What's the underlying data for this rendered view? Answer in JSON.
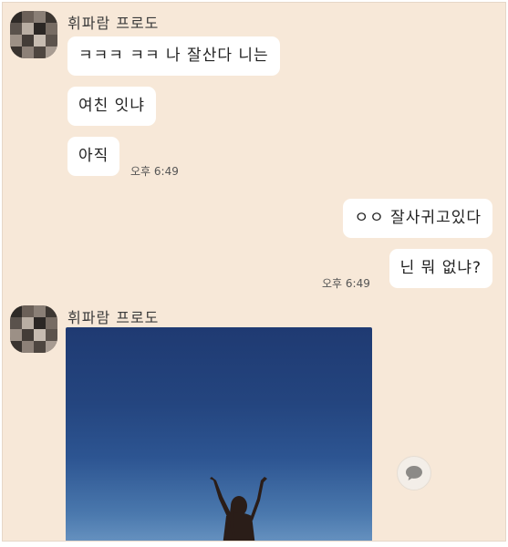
{
  "messages": {
    "sender_name": "휘파람 프로도",
    "received": [
      {
        "text": "ㅋㅋㅋ ㅋㅋ 나 잘산다 니는"
      },
      {
        "text": "여친 잇냐"
      },
      {
        "text": "아직"
      }
    ],
    "received_time": "오후 6:49",
    "sent": [
      {
        "text": "ㅇㅇ 잘사귀고있다"
      },
      {
        "text": "닌 뭐 없냐?"
      }
    ],
    "sent_time": "오후 6:49",
    "second_sender_name": "휘파람 프로도"
  },
  "icons": {
    "share": "speech-bubble-icon"
  },
  "colors": {
    "chat_background": "#f7e8d8",
    "bubble": "#ffffff"
  }
}
